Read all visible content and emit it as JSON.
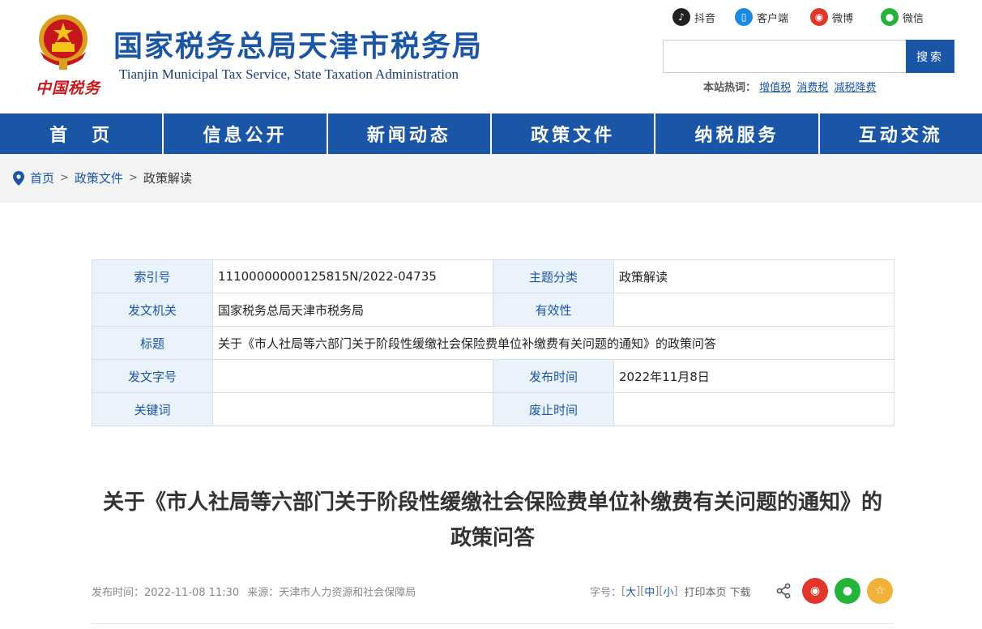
{
  "header": {
    "title": "国家税务总局天津市税务局",
    "subtitle": "Tianjin Municipal Tax Service, State Taxation Administration",
    "logo_text": "中国税务",
    "social": [
      {
        "label": "抖音",
        "icon": "douyin-icon",
        "glyph": "♪"
      },
      {
        "label": "客户端",
        "icon": "mobile-client-icon",
        "glyph": "▯"
      },
      {
        "label": "微博",
        "icon": "weibo-icon",
        "glyph": "◉"
      },
      {
        "label": "微信",
        "icon": "wechat-icon",
        "glyph": "●"
      }
    ],
    "search": {
      "placeholder": "",
      "button": "搜索"
    },
    "hotwords": {
      "label": "本站热词：",
      "items": [
        "增值税",
        "消费税",
        "减税降费"
      ]
    }
  },
  "nav": [
    "首　页",
    "信息公开",
    "新闻动态",
    "政策文件",
    "纳税服务",
    "互动交流"
  ],
  "breadcrumb": {
    "home": "首页",
    "sep": ">",
    "level1": "政策文件",
    "level2": "政策解读"
  },
  "meta": {
    "index_no_label": "索引号",
    "index_no": "11100000000125815N/2022-04735",
    "category_label": "主题分类",
    "category": "政策解读",
    "issuer_label": "发文机关",
    "issuer": "国家税务总局天津市税务局",
    "validity_label": "有效性",
    "validity": "",
    "title_label": "标题",
    "title": "关于《市人社局等六部门关于阶段性缓缴社会保险费单位补缴费有关问题的通知》的政策问答",
    "doc_no_label": "发文字号",
    "doc_no": "",
    "publish_label": "发布时间",
    "publish": "2022年11月8日",
    "keywords_label": "关键词",
    "keywords": "",
    "expire_label": "废止时间",
    "expire": ""
  },
  "article": {
    "title": "关于《市人社局等六部门关于阶段性缓缴社会保险费单位补缴费有关问题的通知》的政策问答",
    "published": "发布时间：2022-11-08 11:30",
    "source": "来源：天津市人力资源和社会保障局",
    "font_label": "字号：",
    "font_large": "大",
    "font_medium": "中",
    "font_small": "小",
    "print": "打印本页",
    "download": "下载"
  },
  "colors": {
    "brand": "#1a55a6",
    "red": "#c8161d",
    "weibo": "#e2362a",
    "wechat": "#23b53a",
    "favorite": "#f0b23a"
  }
}
